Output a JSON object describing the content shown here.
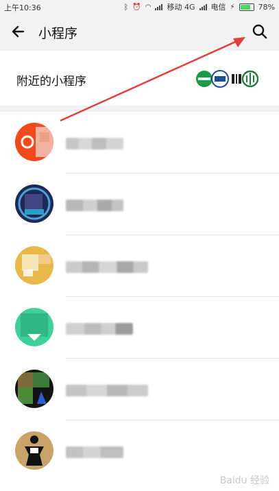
{
  "status_bar": {
    "time": "上午10:36",
    "carrier1": "移动 4G",
    "carrier2": "电信",
    "battery": "78%",
    "battery_level": 0.78
  },
  "header": {
    "title": "小程序",
    "back_icon": "arrow-left-icon",
    "search_icon": "search-icon"
  },
  "nearby": {
    "label": "附近的小程序"
  },
  "list": {
    "items": [
      {
        "avatar_color": "#f04a1c"
      },
      {
        "avatar_color": "#1c2a55"
      },
      {
        "avatar_color": "#e8b84a"
      },
      {
        "avatar_color": "#3ecf9a"
      },
      {
        "avatar_color": "#2b5a2a"
      },
      {
        "avatar_color": "#c8a46a"
      }
    ]
  },
  "watermark": "Baidu 经验"
}
